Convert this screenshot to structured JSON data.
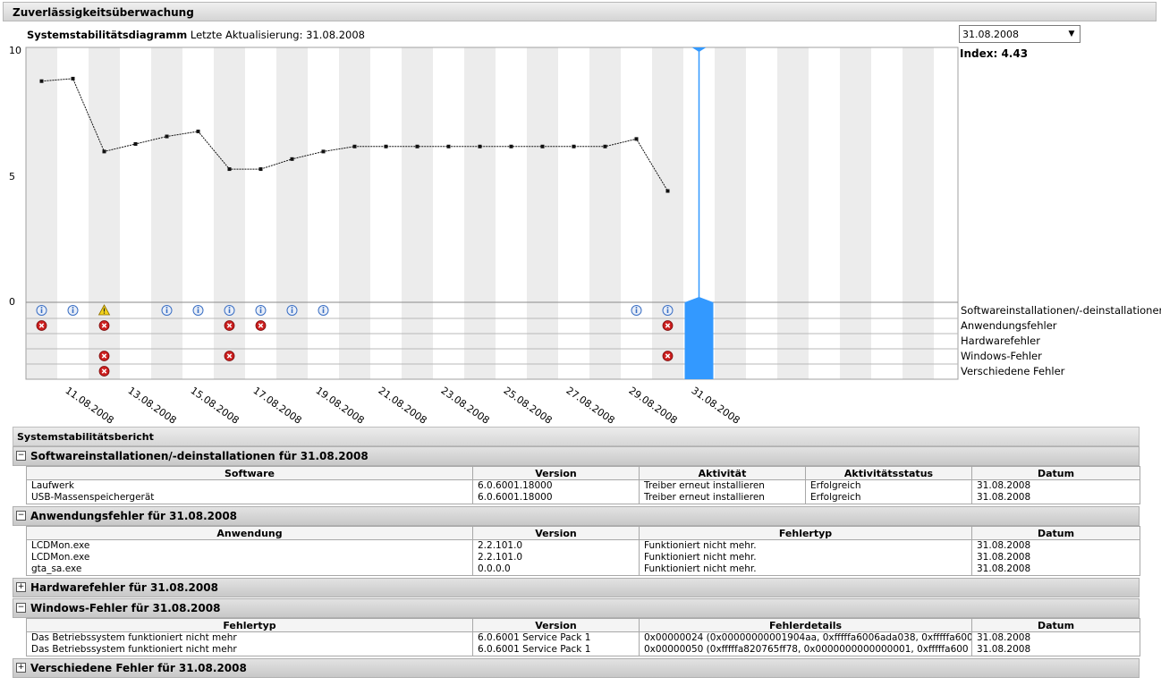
{
  "window": {
    "title": "Zuverlässigkeitsüberwachung"
  },
  "chart_header": {
    "title": "Systemstabilitätsdiagramm",
    "last_update": "Letzte Aktualisierung: 31.08.2008"
  },
  "date_select": {
    "value": "31.08.2008"
  },
  "index_label": "Index: 4.43",
  "chart_data": {
    "type": "line",
    "title": "Systemstabilitätsdiagramm",
    "ylim": [
      0,
      10
    ],
    "yticks": [
      "10",
      "5",
      "0"
    ],
    "x": [
      "10.08.2008",
      "11.08.2008",
      "12.08.2008",
      "13.08.2008",
      "14.08.2008",
      "15.08.2008",
      "16.08.2008",
      "17.08.2008",
      "18.08.2008",
      "19.08.2008",
      "20.08.2008",
      "21.08.2008",
      "22.08.2008",
      "23.08.2008",
      "24.08.2008",
      "25.08.2008",
      "26.08.2008",
      "27.08.2008",
      "28.08.2008",
      "29.08.2008",
      "30.08.2008",
      "31.08.2008"
    ],
    "x_tick_labels": [
      "11.08.2008",
      "13.08.2008",
      "15.08.2008",
      "17.08.2008",
      "19.08.2008",
      "21.08.2008",
      "23.08.2008",
      "25.08.2008",
      "27.08.2008",
      "29.08.2008",
      "31.08.2008"
    ],
    "values": [
      8.8,
      8.9,
      6.0,
      6.3,
      6.6,
      6.8,
      5.3,
      5.3,
      5.7,
      6.0,
      6.2,
      6.2,
      6.2,
      6.2,
      6.2,
      6.2,
      6.2,
      6.2,
      6.2,
      6.5,
      4.43
    ],
    "selected": "31.08.2008",
    "index": 4.43
  },
  "event_rows": [
    {
      "label": "Softwareinstallationen/-deinstallationen",
      "events": [
        {
          "date": "10.08.2008",
          "kind": "info"
        },
        {
          "date": "11.08.2008",
          "kind": "info"
        },
        {
          "date": "12.08.2008",
          "kind": "warning"
        },
        {
          "date": "14.08.2008",
          "kind": "info"
        },
        {
          "date": "15.08.2008",
          "kind": "info"
        },
        {
          "date": "16.08.2008",
          "kind": "info"
        },
        {
          "date": "17.08.2008",
          "kind": "info"
        },
        {
          "date": "18.08.2008",
          "kind": "info"
        },
        {
          "date": "19.08.2008",
          "kind": "info"
        },
        {
          "date": "29.08.2008",
          "kind": "info"
        },
        {
          "date": "30.08.2008",
          "kind": "info"
        }
      ]
    },
    {
      "label": "Anwendungsfehler",
      "events": [
        {
          "date": "10.08.2008",
          "kind": "error"
        },
        {
          "date": "12.08.2008",
          "kind": "error"
        },
        {
          "date": "16.08.2008",
          "kind": "error"
        },
        {
          "date": "17.08.2008",
          "kind": "error"
        },
        {
          "date": "30.08.2008",
          "kind": "error"
        }
      ]
    },
    {
      "label": "Hardwarefehler",
      "events": []
    },
    {
      "label": "Windows-Fehler",
      "events": [
        {
          "date": "12.08.2008",
          "kind": "error"
        },
        {
          "date": "16.08.2008",
          "kind": "error"
        },
        {
          "date": "30.08.2008",
          "kind": "error"
        }
      ]
    },
    {
      "label": "Verschiedene Fehler",
      "events": [
        {
          "date": "12.08.2008",
          "kind": "error"
        }
      ]
    }
  ],
  "report": {
    "title": "Systemstabilitätsbericht",
    "software": {
      "title": "Softwareinstallationen/-deinstallationen für 31.08.2008",
      "toggle": "−",
      "headers": [
        "Software",
        "Version",
        "Aktivität",
        "Aktivitätsstatus",
        "Datum"
      ],
      "rows": [
        [
          "Laufwerk",
          "6.0.6001.18000",
          "Treiber erneut installieren",
          "Erfolgreich",
          "31.08.2008"
        ],
        [
          "USB-Massenspeichergerät",
          "6.0.6001.18000",
          "Treiber erneut installieren",
          "Erfolgreich",
          "31.08.2008"
        ]
      ]
    },
    "app_errors": {
      "title": "Anwendungsfehler für 31.08.2008",
      "toggle": "−",
      "headers": [
        "Anwendung",
        "Version",
        "Fehlertyp",
        "Datum"
      ],
      "rows": [
        [
          "LCDMon.exe",
          "2.2.101.0",
          "Funktioniert nicht mehr.",
          "31.08.2008"
        ],
        [
          "LCDMon.exe",
          "2.2.101.0",
          "Funktioniert nicht mehr.",
          "31.08.2008"
        ],
        [
          "gta_sa.exe",
          "0.0.0.0",
          "Funktioniert nicht mehr.",
          "31.08.2008"
        ]
      ]
    },
    "hardware": {
      "title": "Hardwarefehler für 31.08.2008",
      "toggle": "+"
    },
    "windows_errors": {
      "title": "Windows-Fehler für 31.08.2008",
      "toggle": "−",
      "headers": [
        "Fehlertyp",
        "Version",
        "Fehlerdetails",
        "Datum"
      ],
      "rows": [
        [
          "Das Betriebssystem funktioniert nicht mehr",
          "6.0.6001 Service Pack 1",
          "0x00000024 (0x00000000001904aa, 0xfffffa6006ada038, 0xfffffa600",
          "31.08.2008"
        ],
        [
          "Das Betriebssystem funktioniert nicht mehr",
          "6.0.6001 Service Pack 1",
          "0x00000050 (0xfffffa820765ff78, 0x0000000000000001, 0xfffffa600",
          "31.08.2008"
        ]
      ]
    },
    "misc": {
      "title": "Verschiedene Fehler für 31.08.2008",
      "toggle": "+"
    }
  },
  "colors": {
    "selected": "#3399ff",
    "stripe": "#ececec",
    "error": "#cc1f1f",
    "info": "#3a6fc4",
    "warning": "#f2d21b"
  }
}
